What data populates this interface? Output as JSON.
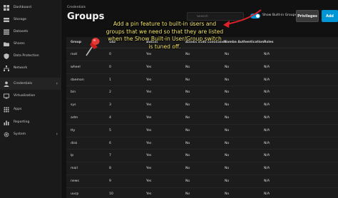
{
  "sidebar": {
    "items": [
      {
        "label": "Dashboard",
        "icon": "dashboard-icon"
      },
      {
        "label": "Storage",
        "icon": "storage-icon"
      },
      {
        "label": "Datasets",
        "icon": "datasets-icon"
      },
      {
        "label": "Shares",
        "icon": "shares-icon"
      },
      {
        "label": "Data Protection",
        "icon": "data-protection-icon"
      },
      {
        "label": "Network",
        "icon": "network-icon"
      },
      {
        "label": "Credentials",
        "icon": "credentials-icon",
        "chevron": "›"
      },
      {
        "label": "Virtualization",
        "icon": "virtualization-icon"
      },
      {
        "label": "Apps",
        "icon": "apps-icon"
      },
      {
        "label": "Reporting",
        "icon": "reporting-icon"
      },
      {
        "label": "System",
        "icon": "system-icon",
        "chevron": "›"
      }
    ]
  },
  "header": {
    "breadcrumb": "Credentials",
    "title": "Groups",
    "search_placeholder": "Search",
    "toggle_label": "Show Built-in Groups",
    "privileges_label": "Privileges",
    "add_label": "Add"
  },
  "table": {
    "columns": [
      "Group",
      "GID",
      "Builtin",
      "Allows sudo commands",
      "Samba Authentication",
      "Roles"
    ],
    "rows": [
      [
        "root",
        "0",
        "Yes",
        "No",
        "No",
        "N/A"
      ],
      [
        "wheel",
        "0",
        "Yes",
        "No",
        "No",
        "N/A"
      ],
      [
        "daemon",
        "1",
        "Yes",
        "No",
        "No",
        "N/A"
      ],
      [
        "bin",
        "2",
        "Yes",
        "No",
        "No",
        "N/A"
      ],
      [
        "sys",
        "3",
        "Yes",
        "No",
        "No",
        "N/A"
      ],
      [
        "adm",
        "4",
        "Yes",
        "No",
        "No",
        "N/A"
      ],
      [
        "tty",
        "5",
        "Yes",
        "No",
        "No",
        "N/A"
      ],
      [
        "disk",
        "6",
        "Yes",
        "No",
        "No",
        "N/A"
      ],
      [
        "lp",
        "7",
        "Yes",
        "No",
        "No",
        "N/A"
      ],
      [
        "mail",
        "8",
        "Yes",
        "No",
        "No",
        "N/A"
      ],
      [
        "news",
        "9",
        "Yes",
        "No",
        "No",
        "N/A"
      ],
      [
        "uucp",
        "10",
        "Yes",
        "No",
        "No",
        "N/A"
      ]
    ]
  },
  "annotation": {
    "text": "Add a pin feature to built-in users and groups that we need so that they are listed when the Show Built-in User/Group switch is tuned off.",
    "color": "#f5e66a",
    "arrow_color": "#e0202a"
  },
  "colors": {
    "accent": "#0095d5",
    "background": "#111111",
    "sidebar": "#1a1a1a"
  }
}
